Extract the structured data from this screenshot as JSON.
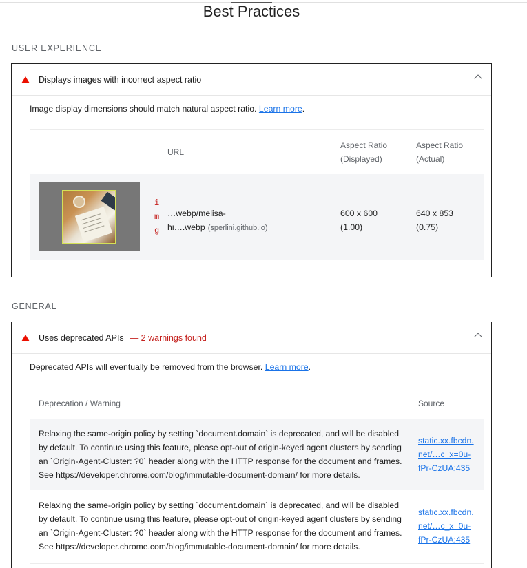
{
  "page": {
    "title": "Best Practices"
  },
  "groups": {
    "user_experience": "USER EXPERIENCE",
    "general": "GENERAL"
  },
  "audit_aspect_ratio": {
    "title": "Displays images with incorrect aspect ratio",
    "description": "Image display dimensions should match natural aspect ratio.",
    "learn_more": "Learn more",
    "period": ".",
    "headers": {
      "url": "URL",
      "displayed_line1": "Aspect Ratio",
      "displayed_line2": "(Displayed)",
      "actual_line1": "Aspect Ratio",
      "actual_line2": "(Actual)"
    },
    "row": {
      "node_letters": [
        "i",
        "m",
        "g"
      ],
      "url_line1": "…webp/melisa-",
      "url_line2": "hi….webp",
      "host": "(sperlini.github.io)",
      "displayed_size": "600 x 600",
      "displayed_ratio": "(1.00)",
      "actual_size": "640 x 853",
      "actual_ratio": "(0.75)"
    }
  },
  "audit_deprecated": {
    "title": "Uses deprecated APIs",
    "display_value": "— 2 warnings found",
    "description": "Deprecated APIs will eventually be removed from the browser.",
    "learn_more": "Learn more",
    "period": ".",
    "headers": {
      "warning": "Deprecation / Warning",
      "source": "Source"
    },
    "rows": [
      {
        "lines": [
          "Relaxing the same-origin policy by setting `document.domain` is deprecated, and will be disabled",
          "by default. To continue using this feature, please opt-out of origin-keyed agent clusters by sending",
          "an `Origin-Agent-Cluster: ?0` header along with the HTTP response for the document and frames.",
          "See https://developer.chrome.com/blog/immutable-document-domain/ for more details."
        ],
        "source_lines": [
          "static.xx.fbcdn.",
          "net/…c_x=0u-",
          "fPr-CzUA:435"
        ]
      },
      {
        "lines": [
          "Relaxing the same-origin policy by setting `document.domain` is deprecated, and will be disabled",
          "by default. To continue using this feature, please opt-out of origin-keyed agent clusters by sending",
          "an `Origin-Agent-Cluster: ?0` header along with the HTTP response for the document and frames.",
          "See https://developer.chrome.com/blog/immutable-document-domain/ for more details."
        ],
        "source_lines": [
          "static.xx.fbcdn.",
          "net/…c_x=0u-",
          "fPr-CzUA:435"
        ]
      }
    ]
  },
  "colors": {
    "fail": "#eb0f00",
    "link": "#1a73e8",
    "node": "#c5221f"
  },
  "icons": {
    "fail": "warning-triangle-icon",
    "collapse": "chevron-up-icon"
  }
}
